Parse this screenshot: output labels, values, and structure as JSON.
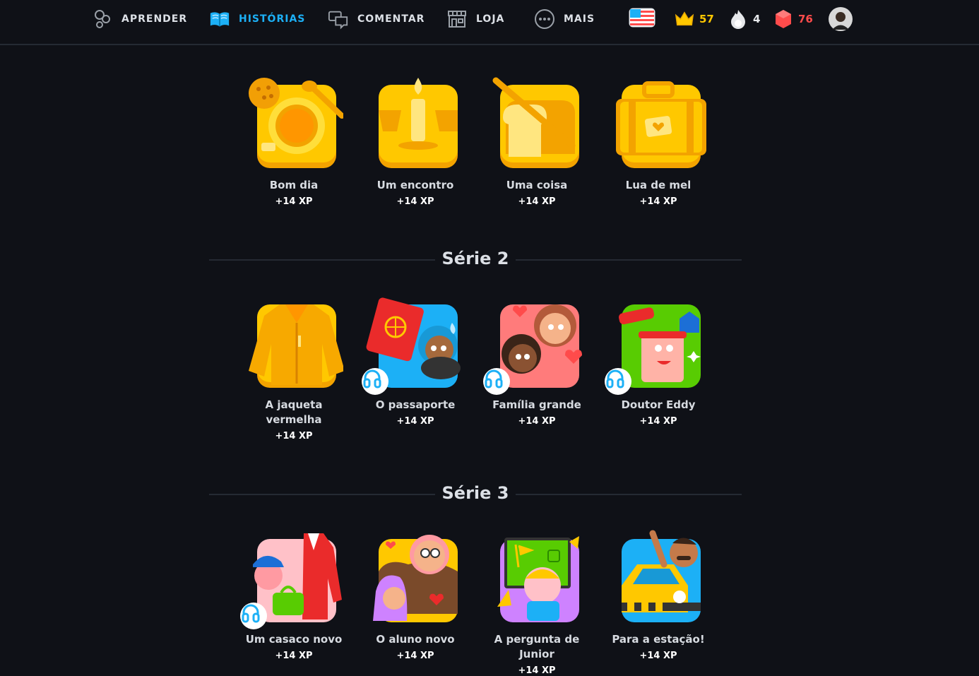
{
  "nav": {
    "items": [
      {
        "label": "APRENDER",
        "icon": "learn-icon"
      },
      {
        "label": "HISTÓRIAS",
        "icon": "book-icon"
      },
      {
        "label": "COMENTAR",
        "icon": "chat-icon"
      },
      {
        "label": "LOJA",
        "icon": "shop-icon"
      },
      {
        "label": "MAIS",
        "icon": "more-icon"
      }
    ],
    "active": "HISTÓRIAS",
    "stats": {
      "flag": "us-flag-icon",
      "crowns": "57",
      "streak": "4",
      "gems": "76"
    }
  },
  "series": [
    {
      "title": "",
      "stories": [
        {
          "name": "Bom dia",
          "xp": "+14 XP",
          "icon": "coffee-cup-icon",
          "audio": false
        },
        {
          "name": "Um encontro",
          "xp": "+14 XP",
          "icon": "candle-icon",
          "audio": false
        },
        {
          "name": "Uma coisa",
          "xp": "+14 XP",
          "icon": "bread-icon",
          "audio": false
        },
        {
          "name": "Lua de mel",
          "xp": "+14 XP",
          "icon": "suitcase-icon",
          "audio": false
        }
      ]
    },
    {
      "title": "Série 2",
      "stories": [
        {
          "name": "A jaqueta vermelha",
          "xp": "+14 XP",
          "icon": "jacket-icon",
          "audio": false
        },
        {
          "name": "O passaporte",
          "xp": "+14 XP",
          "icon": "passport-icon",
          "audio": true
        },
        {
          "name": "Família grande",
          "xp": "+14 XP",
          "icon": "family-icon",
          "audio": true
        },
        {
          "name": "Doutor Eddy",
          "xp": "+14 XP",
          "icon": "doctor-icon",
          "audio": true
        }
      ]
    },
    {
      "title": "Série 3",
      "stories": [
        {
          "name": "Um casaco novo",
          "xp": "+14 XP",
          "icon": "coat-icon",
          "audio": true
        },
        {
          "name": "O aluno novo",
          "xp": "+14 XP",
          "icon": "student-icon",
          "audio": false
        },
        {
          "name": "A pergunta de Junior",
          "xp": "+14 XP",
          "icon": "question-icon",
          "audio": false
        },
        {
          "name": "Para a estação!",
          "xp": "+14 XP",
          "icon": "taxi-icon",
          "audio": false
        }
      ]
    }
  ],
  "colors": {
    "accent": "#1cb0f6",
    "crown": "#ffc800",
    "gem": "#ff4b4b",
    "background": "#0f1117"
  }
}
